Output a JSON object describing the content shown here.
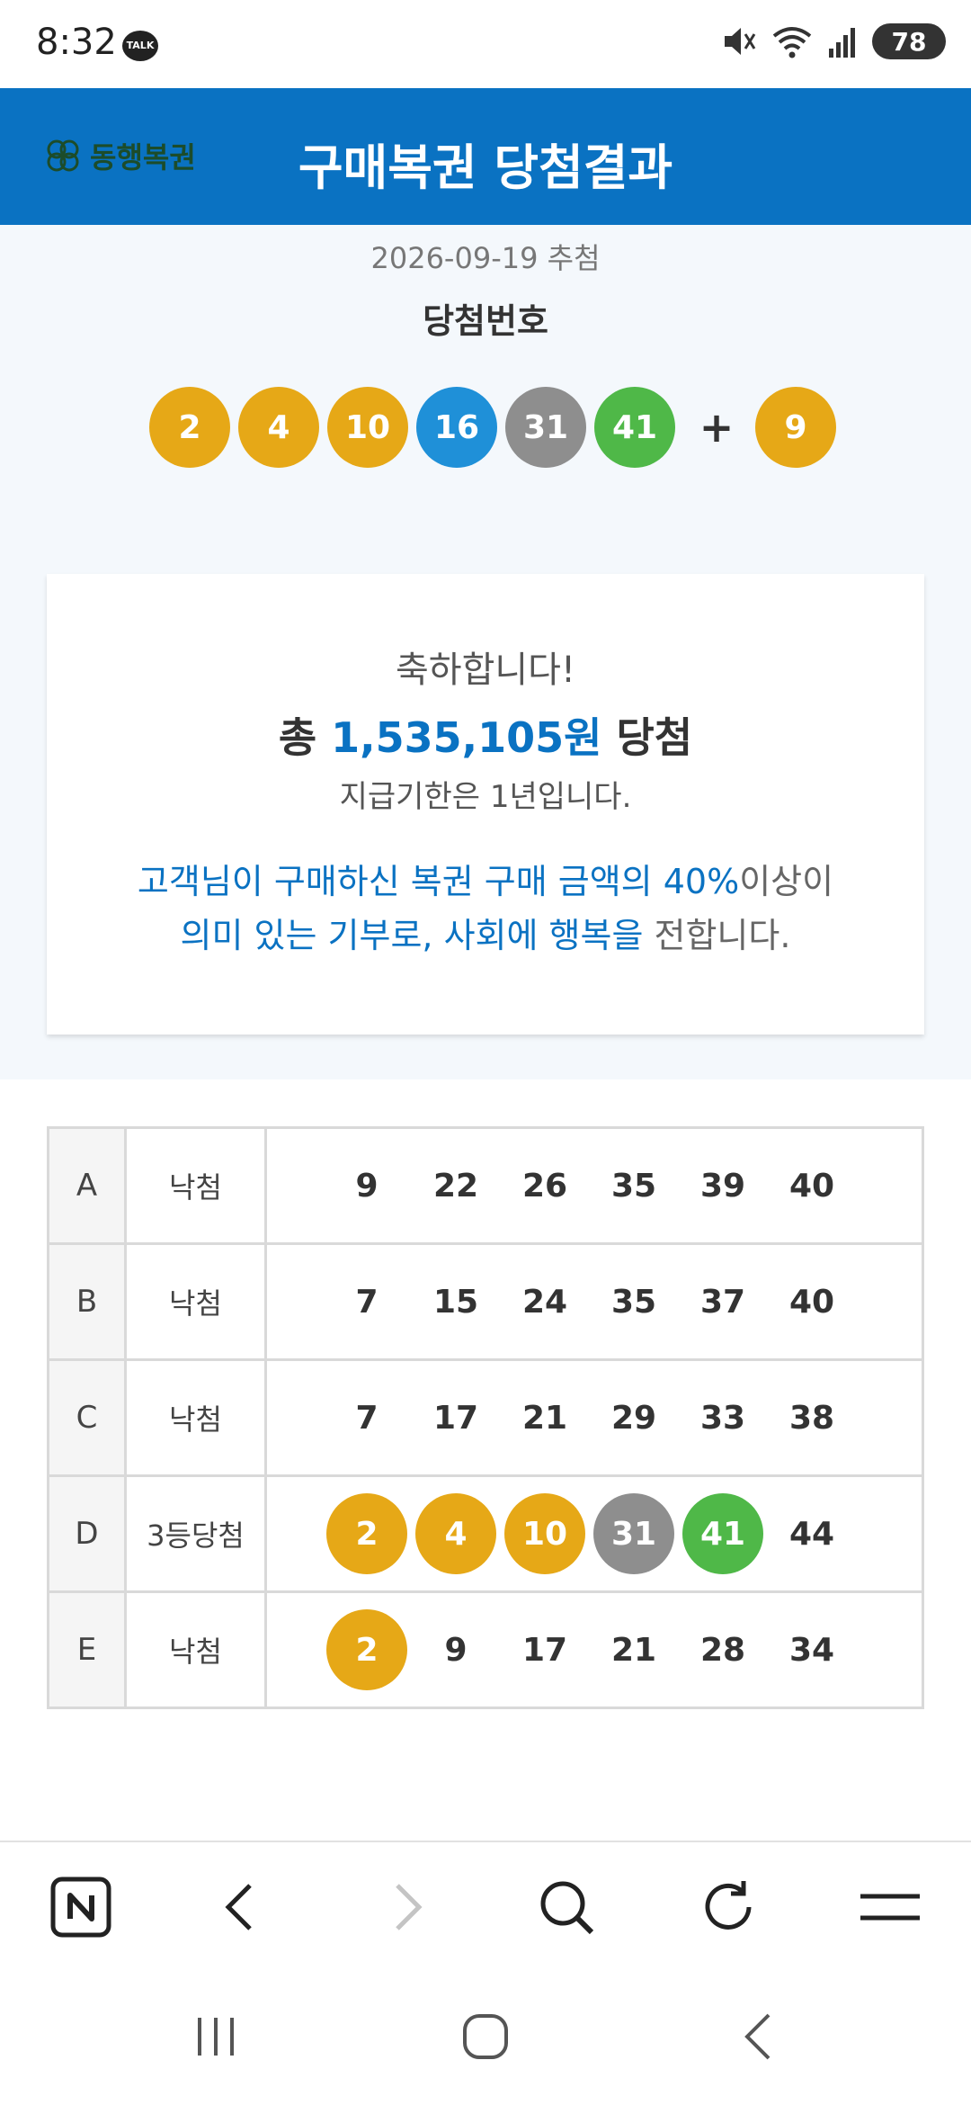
{
  "status": {
    "time": "8:32",
    "talk_badge": "TALK",
    "battery": "78"
  },
  "header": {
    "logo_text": "동행복권",
    "title": "구매복권 당첨결과"
  },
  "draw": {
    "date_label": "2026-09-19 추첨",
    "winning_label": "당첨번호",
    "numbers": [
      {
        "n": "2",
        "color": "#e6a817"
      },
      {
        "n": "4",
        "color": "#e6a817"
      },
      {
        "n": "10",
        "color": "#e6a817"
      },
      {
        "n": "16",
        "color": "#1f90d8"
      },
      {
        "n": "31",
        "color": "#8e8e8e"
      },
      {
        "n": "41",
        "color": "#4fb848"
      }
    ],
    "plus": "+",
    "bonus": {
      "n": "9",
      "color": "#e6a817"
    }
  },
  "result_card": {
    "congrats": "축하합니다!",
    "total_prefix": "총 ",
    "total_amount": "1,535,105원",
    "total_suffix": " 당첨",
    "deadline": "지급기한은 1년입니다.",
    "donate_1": "고객님이 구매하신 복권 구매 금액의 40%",
    "donate_2": "이상이",
    "donate_3": "의미 있는 기부로, 사회에 행복을",
    "donate_4": " 전합니다."
  },
  "colors": {
    "accent": "#0a72c2",
    "yellow": "#e6a817",
    "blue": "#1f90d8",
    "gray": "#8e8e8e",
    "green": "#4fb848"
  },
  "games": [
    {
      "id": "A",
      "result": "낙첨",
      "numbers": [
        {
          "n": "9"
        },
        {
          "n": "22"
        },
        {
          "n": "26"
        },
        {
          "n": "35"
        },
        {
          "n": "39"
        },
        {
          "n": "40"
        }
      ]
    },
    {
      "id": "B",
      "result": "낙첨",
      "numbers": [
        {
          "n": "7"
        },
        {
          "n": "15"
        },
        {
          "n": "24"
        },
        {
          "n": "35"
        },
        {
          "n": "37"
        },
        {
          "n": "40"
        }
      ]
    },
    {
      "id": "C",
      "result": "낙첨",
      "numbers": [
        {
          "n": "7"
        },
        {
          "n": "17"
        },
        {
          "n": "21"
        },
        {
          "n": "29"
        },
        {
          "n": "33"
        },
        {
          "n": "38"
        }
      ]
    },
    {
      "id": "D",
      "result": "3등당첨",
      "numbers": [
        {
          "n": "2",
          "color": "#e6a817"
        },
        {
          "n": "4",
          "color": "#e6a817"
        },
        {
          "n": "10",
          "color": "#e6a817"
        },
        {
          "n": "31",
          "color": "#8e8e8e"
        },
        {
          "n": "41",
          "color": "#4fb848"
        },
        {
          "n": "44"
        }
      ]
    },
    {
      "id": "E",
      "result": "낙첨",
      "numbers": [
        {
          "n": "2",
          "color": "#e6a817"
        },
        {
          "n": "9"
        },
        {
          "n": "17"
        },
        {
          "n": "21"
        },
        {
          "n": "28"
        },
        {
          "n": "34"
        }
      ]
    }
  ],
  "browser_nav": [
    "naver-home-icon",
    "back-icon",
    "forward-icon",
    "search-icon",
    "refresh-icon",
    "menu-icon"
  ],
  "system_nav": [
    "recent-apps-icon",
    "home-icon",
    "system-back-icon"
  ]
}
